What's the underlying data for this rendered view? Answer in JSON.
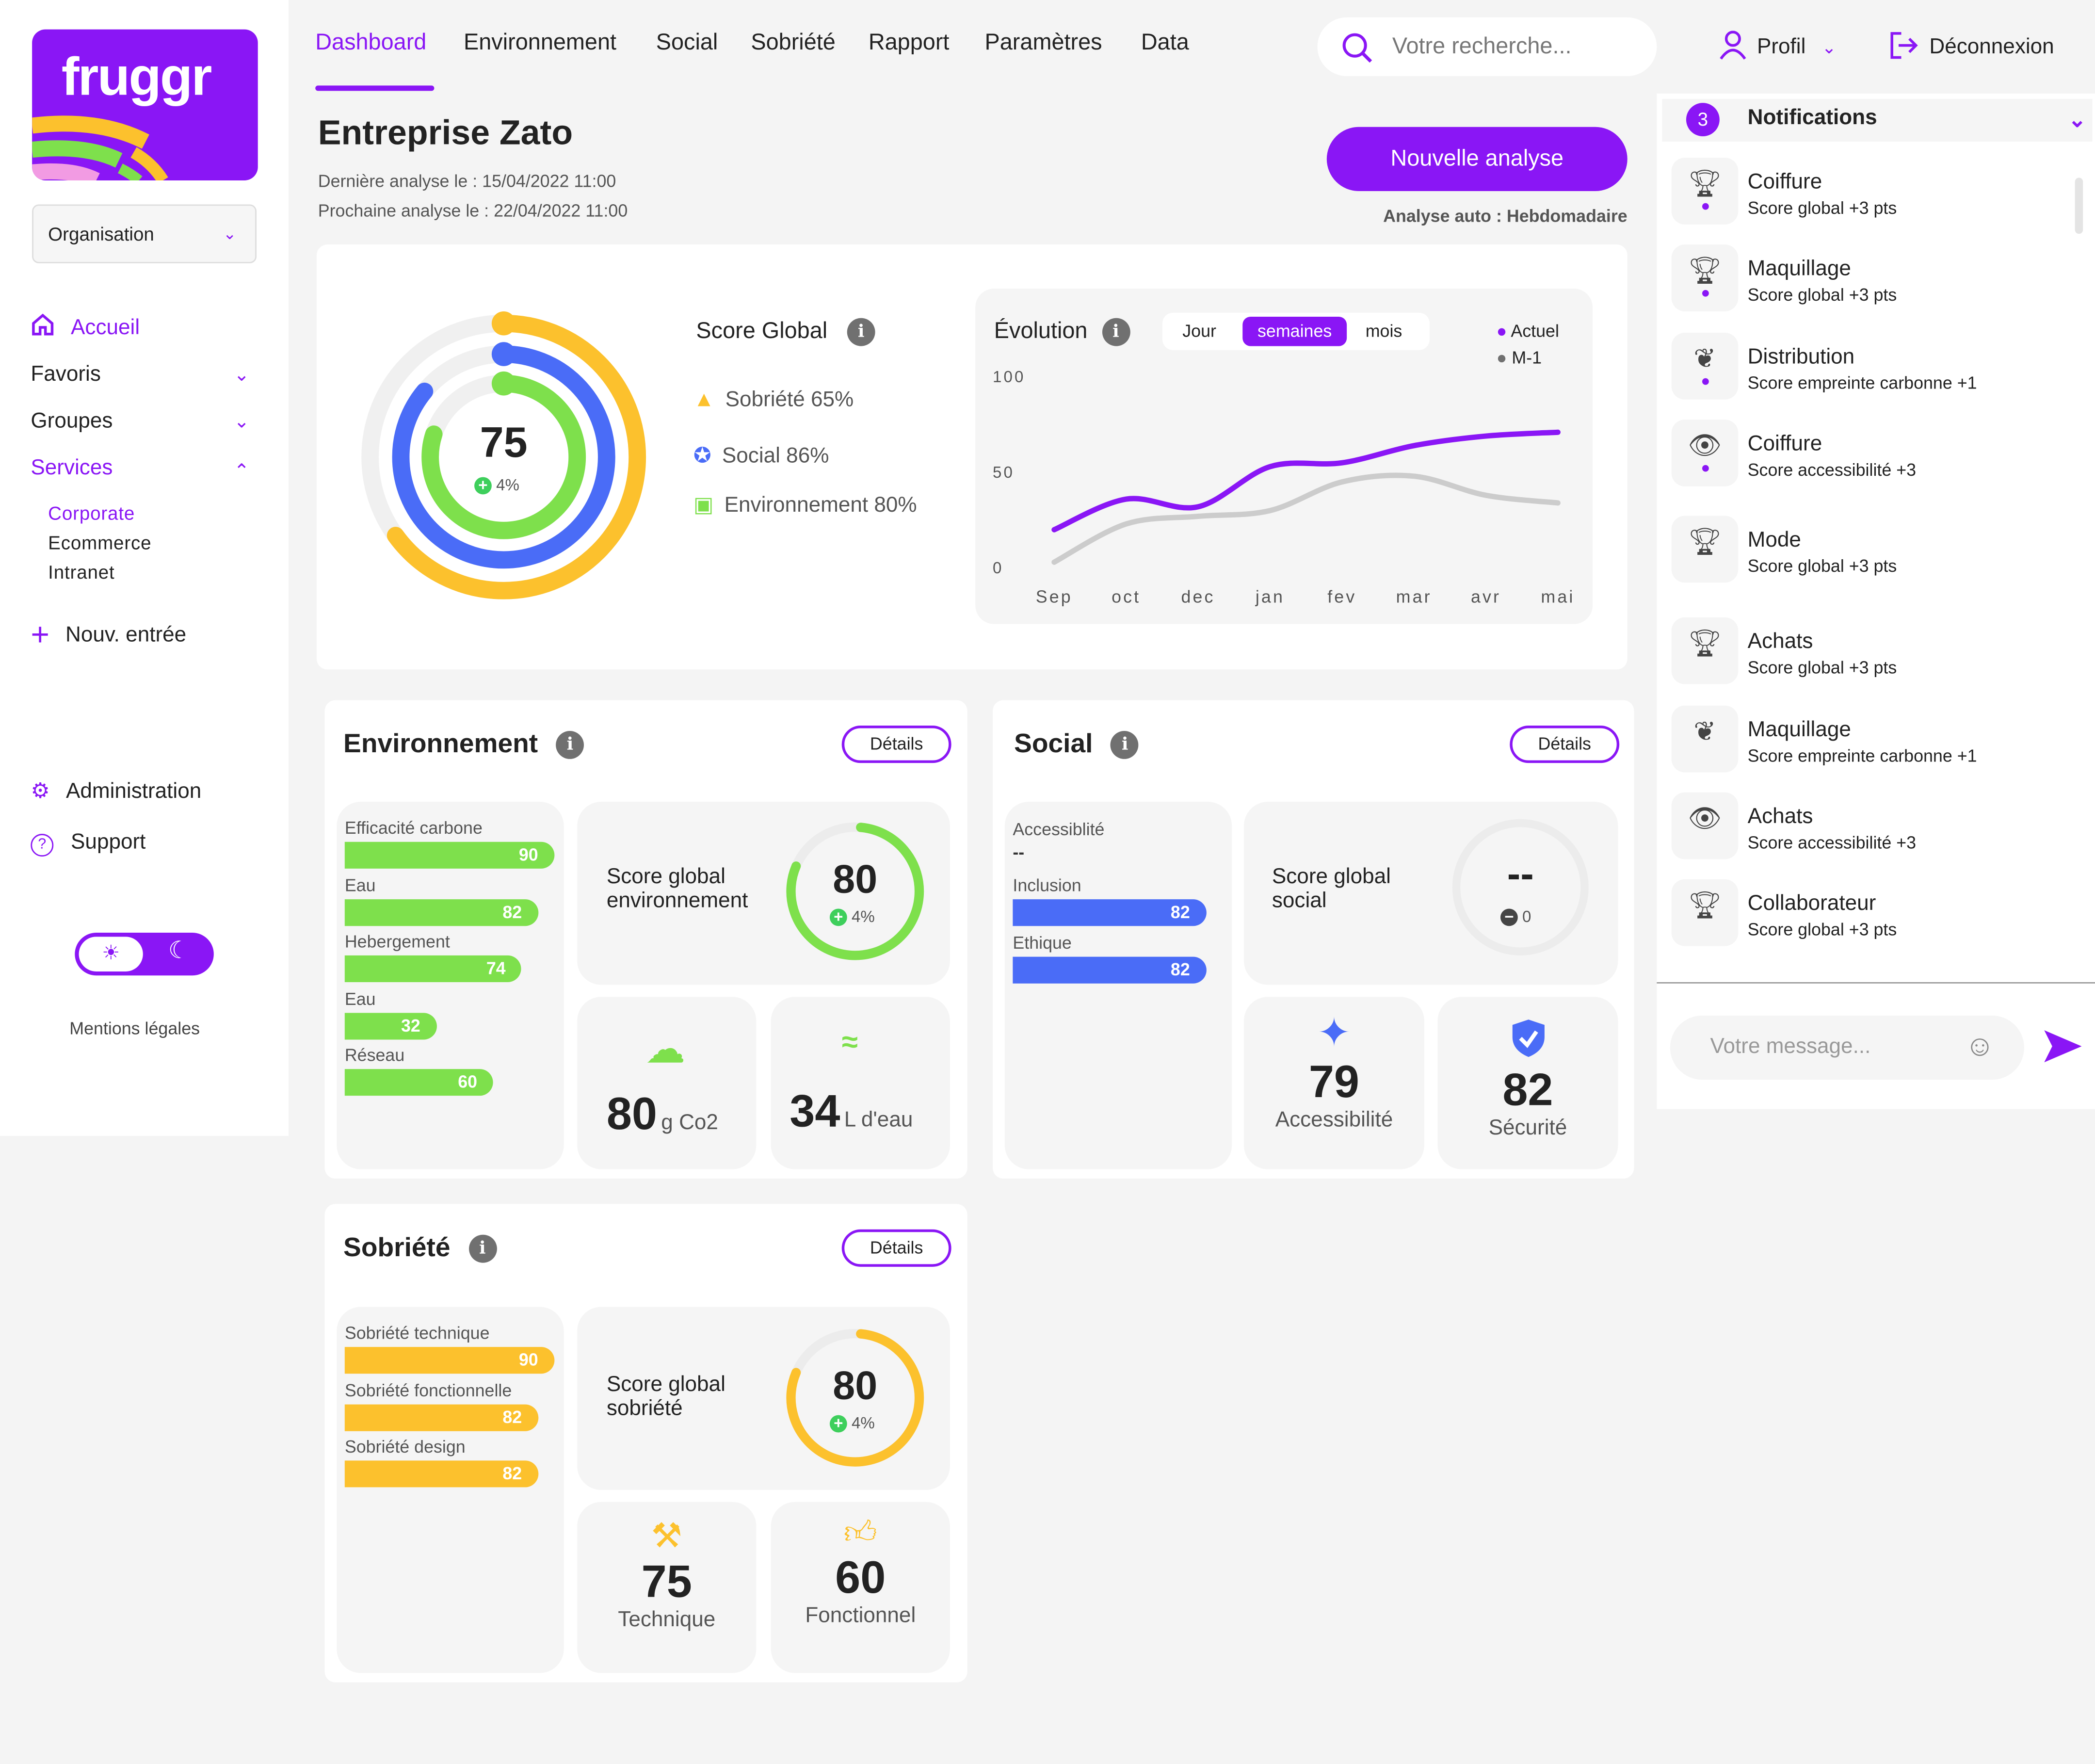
{
  "brand": {
    "logo_text": "fruggr",
    "accent": "#8a16f5"
  },
  "sidebar": {
    "organisation_select": "Organisation",
    "items": [
      {
        "label": "Accueil",
        "active": true
      },
      {
        "label": "Favoris"
      },
      {
        "label": "Groupes"
      },
      {
        "label": "Services",
        "expanded": true
      }
    ],
    "services_sub": [
      {
        "label": "Corporate",
        "active": true
      },
      {
        "label": "Ecommerce"
      },
      {
        "label": "Intranet"
      }
    ],
    "new_entry": "Nouv. entrée",
    "administration": "Administration",
    "support": "Support",
    "theme": "light",
    "legal": "Mentions légales"
  },
  "topnav": {
    "tabs": [
      "Dashboard",
      "Environnement",
      "Social",
      "Sobriété",
      "Rapport",
      "Paramètres",
      "Data"
    ],
    "active": "Dashboard",
    "search_placeholder": "Votre recherche...",
    "profile": "Profil",
    "logout": "Déconnexion"
  },
  "header": {
    "title": "Entreprise Zato",
    "last_analysis": "Dernière analyse le : 15/04/2022 11:00",
    "next_analysis": "Prochaine analyse le : 22/04/2022 11:00",
    "new_analysis_button": "Nouvelle analyse",
    "auto_analysis": "Analyse auto : Hebdomadaire"
  },
  "global": {
    "score": "75",
    "delta": "4%",
    "title": "Score Global",
    "legend": [
      {
        "label": "Sobriété 65%",
        "value": 65,
        "color": "#fcc12d"
      },
      {
        "label": "Social 86%",
        "value": 86,
        "color": "#4a6cf7"
      },
      {
        "label": "Environnement 80%",
        "value": 80,
        "color": "#7ee04c"
      }
    ]
  },
  "chart_data": {
    "type": "line",
    "title": "Évolution",
    "periods": [
      "Jour",
      "semaines",
      "mois"
    ],
    "active_period": "semaines",
    "categories": [
      "Sep",
      "oct",
      "dec",
      "jan",
      "fev",
      "mar",
      "avr",
      "mai"
    ],
    "yticks": [
      "100",
      "50",
      "0"
    ],
    "ylim": [
      0,
      100
    ],
    "grid": false,
    "legend_placement": "top-right",
    "series": [
      {
        "name": "Actuel",
        "color": "#8a16f5",
        "values": [
          20,
          36,
          32,
          53,
          55,
          64,
          69,
          71
        ]
      },
      {
        "name": "M-1",
        "color": "#cccccc",
        "values": [
          3,
          23,
          27,
          30,
          45,
          48,
          38,
          34
        ]
      }
    ]
  },
  "environment": {
    "title": "Environnement",
    "details": "Détails",
    "color": "#7ee04c",
    "bars": [
      {
        "label": "Efficacité carbone",
        "value": 90
      },
      {
        "label": "Eau",
        "value": 82
      },
      {
        "label": "Hebergement",
        "value": 74
      },
      {
        "label": "Eau",
        "value": 32
      },
      {
        "label": "Réseau",
        "value": 60
      }
    ],
    "score_label": "Score global environnement",
    "score": "80",
    "score_value": 80,
    "delta": "4%",
    "co2_value": "80",
    "co2_unit": "g Co2",
    "water_value": "34",
    "water_unit": "L d'eau"
  },
  "social": {
    "title": "Social",
    "details": "Détails",
    "color": "#4a6cf7",
    "first_label": "Accessiblité",
    "first_value": "--",
    "bars": [
      {
        "label": "Inclusion",
        "value": 82
      },
      {
        "label": "Ethique",
        "value": 82
      }
    ],
    "score_label": "Score global social",
    "score": "--",
    "delta": "0",
    "accessibility_value": "79",
    "accessibility_label": "Accessibilité",
    "security_value": "82",
    "security_label": "Sécurité"
  },
  "sobriety": {
    "title": "Sobriété",
    "details": "Détails",
    "color": "#fcc12d",
    "bars": [
      {
        "label": "Sobriété technique",
        "value": 90
      },
      {
        "label": "Sobriété fonctionnelle",
        "value": 82
      },
      {
        "label": "Sobriété design",
        "value": 82
      }
    ],
    "score_label": "Score global sobriété",
    "score": "80",
    "score_value": 80,
    "delta": "4%",
    "technique_value": "75",
    "technique_label": "Technique",
    "functional_value": "60",
    "functional_label": "Fonctionnel"
  },
  "notifications": {
    "count": "3",
    "title": "Notifications",
    "message_placeholder": "Votre message...",
    "items": [
      {
        "title": "Coiffure",
        "text": "Score global +3 pts",
        "icon": "trophy-icon",
        "unread": true
      },
      {
        "title": "Maquillage",
        "text": "Score global +3 pts",
        "icon": "trophy-icon",
        "unread": true
      },
      {
        "title": "Distribution",
        "text": "Score empreinte carbonne +1",
        "icon": "leaf-icon",
        "unread": true
      },
      {
        "title": "Coiffure",
        "text": "Score accessibilité +3",
        "icon": "eye-icon",
        "unread": true
      },
      {
        "title": "Mode",
        "text": "Score global +3 pts",
        "icon": "trophy-icon"
      },
      {
        "title": "Achats",
        "text": "Score global +3 pts",
        "icon": "trophy-icon"
      },
      {
        "title": "Maquillage",
        "text": "Score empreinte carbonne +1",
        "icon": "leaf-icon"
      },
      {
        "title": "Achats",
        "text": "Score accessibilité +3",
        "icon": "eye-icon"
      },
      {
        "title": "Collaborateur",
        "text": "Score global +3 pts",
        "icon": "trophy-icon"
      }
    ]
  }
}
